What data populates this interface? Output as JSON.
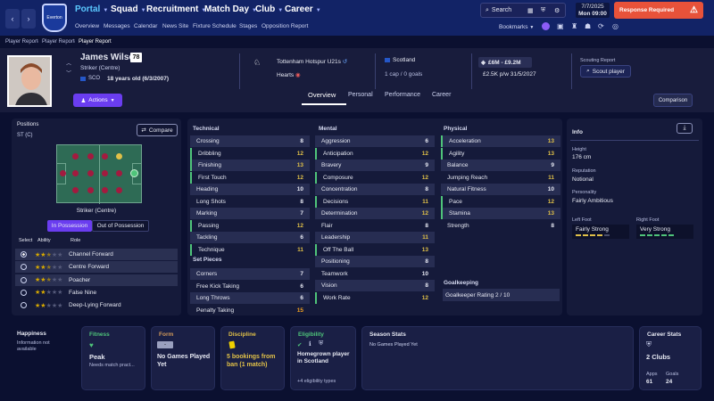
{
  "nav": {
    "back": "‹",
    "forward": "›",
    "club_badge": "Everton",
    "menus": [
      "Portal",
      "Squad",
      "Recruitment",
      "Match Day",
      "Club",
      "Career"
    ],
    "sub": [
      "Overview",
      "Messages",
      "Calendar",
      "News Site",
      "Fixture Schedule",
      "Stages",
      "Opposition Report"
    ],
    "search": "Search",
    "date": "7/7/2025",
    "day_time": "Mon 09:00",
    "response": "Response Required",
    "bookmarks": "Bookmarks"
  },
  "breadcrumb": [
    "Player Report",
    "Player Report",
    "Player Report"
  ],
  "player": {
    "name": "James Wilson",
    "rating": "78",
    "position": "Striker (Centre)",
    "nation_code": "SCO",
    "age": "18 years old (6/3/2007)",
    "club1": "Tottenham Hotspur U21s",
    "club2": "Hearts",
    "nationality": "Scotland",
    "caps": "1 cap / 0 goals",
    "value": "£6M - £9.2M",
    "wage": "£2.5K p/w 31/5/2027",
    "scouting_label": "Scouting Report",
    "scout_button": "Scout player",
    "actions": "Actions"
  },
  "tabs": [
    "Overview",
    "Personal",
    "Performance",
    "Career"
  ],
  "comparison": "Comparison",
  "positions": {
    "label": "Positions",
    "value": "ST (C)",
    "compare": "Compare",
    "role_caption": "Striker (Centre)",
    "poss_in": "In Possession",
    "poss_out": "Out of Possession",
    "headers": [
      "Select",
      "Ability",
      "Role"
    ],
    "roles": [
      {
        "name": "Channel Forward",
        "stars": 2.5
      },
      {
        "name": "Centre Forward",
        "stars": 2.5
      },
      {
        "name": "Poacher",
        "stars": 2.5
      },
      {
        "name": "False Nine",
        "stars": 2
      },
      {
        "name": "Deep-Lying Forward",
        "stars": 2
      }
    ]
  },
  "technical": {
    "title": "Technical",
    "rows": [
      [
        "Crossing",
        "8"
      ],
      [
        "Dribbling",
        "12"
      ],
      [
        "Finishing",
        "13"
      ],
      [
        "First Touch",
        "12"
      ],
      [
        "Heading",
        "10"
      ],
      [
        "Long Shots",
        "8"
      ],
      [
        "Marking",
        "7"
      ],
      [
        "Passing",
        "12"
      ],
      [
        "Tackling",
        "6"
      ],
      [
        "Technique",
        "11"
      ]
    ]
  },
  "setpieces": {
    "title": "Set Pieces",
    "rows": [
      [
        "Corners",
        "7"
      ],
      [
        "Free Kick Taking",
        "6"
      ],
      [
        "Long Throws",
        "6"
      ],
      [
        "Penalty Taking",
        "15"
      ]
    ]
  },
  "mental": {
    "title": "Mental",
    "rows": [
      [
        "Aggression",
        "6"
      ],
      [
        "Anticipation",
        "12"
      ],
      [
        "Bravery",
        "9"
      ],
      [
        "Composure",
        "12"
      ],
      [
        "Concentration",
        "8"
      ],
      [
        "Decisions",
        "11"
      ],
      [
        "Determination",
        "12"
      ],
      [
        "Flair",
        "8"
      ],
      [
        "Leadership",
        "11"
      ],
      [
        "Off The Ball",
        "13"
      ],
      [
        "Positioning",
        "8"
      ],
      [
        "Teamwork",
        "10"
      ],
      [
        "Vision",
        "8"
      ],
      [
        "Work Rate",
        "12"
      ]
    ]
  },
  "physical": {
    "title": "Physical",
    "rows": [
      [
        "Acceleration",
        "13"
      ],
      [
        "Agility",
        "13"
      ],
      [
        "Balance",
        "9"
      ],
      [
        "Jumping Reach",
        "11"
      ],
      [
        "Natural Fitness",
        "10"
      ],
      [
        "Pace",
        "12"
      ],
      [
        "Stamina",
        "13"
      ],
      [
        "Strength",
        "8"
      ]
    ]
  },
  "goalkeeping": {
    "title": "Goalkeeping",
    "rating": "Goalkeeper Rating  2 / 10"
  },
  "info": {
    "title": "Info",
    "height_label": "Height",
    "height": "176 cm",
    "rep_label": "Reputation",
    "rep": "Notional",
    "pers_label": "Personality",
    "pers": "Fairly Ambitious",
    "lf_label": "Left Foot",
    "lf": "Fairly Strong",
    "rf_label": "Right Foot",
    "rf": "Very Strong"
  },
  "cards": {
    "happiness": {
      "title": "Happiness",
      "text": "Information not available"
    },
    "fitness": {
      "title": "Fitness",
      "value": "Peak",
      "sub": "Needs match pract..."
    },
    "form": {
      "title": "Form",
      "badge": "-",
      "value": "No Games Played Yet"
    },
    "discipline": {
      "title": "Discipline",
      "value": "5 bookings from ban (1 match)"
    },
    "eligibility": {
      "title": "Eligibility",
      "value": "Homegrown player in Scotland",
      "sub": "+4 eligibility types"
    },
    "season": {
      "title": "Season Stats",
      "value": "No Games Played Yet"
    },
    "career": {
      "title": "Career Stats",
      "value": "2 Clubs",
      "apps_label": "Apps",
      "apps": "61",
      "goals_label": "Goals",
      "goals": "24"
    }
  },
  "colors": {
    "accent": "#6a3df0",
    "alert": "#e8523a",
    "good": "#4fc47a",
    "highlight": "#e0c048"
  }
}
